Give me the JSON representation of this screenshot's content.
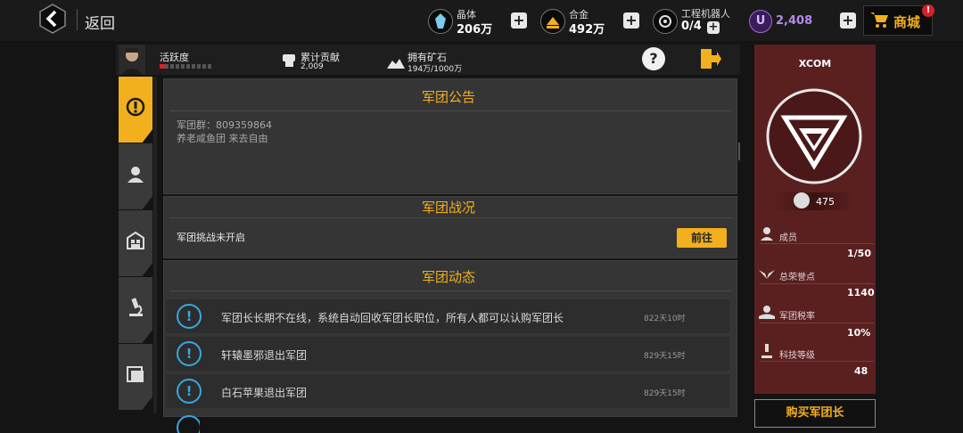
{
  "top": {
    "back_label": "返回",
    "resources": [
      {
        "name": "晶体",
        "value": "206万",
        "icon": "crystal-icon"
      },
      {
        "name": "合金",
        "value": "492万",
        "icon": "alloy-icon"
      },
      {
        "name": "工程机器人",
        "value": "0/4",
        "icon": "robot-icon"
      }
    ],
    "currency_value": "2,408",
    "shop_label": "商城",
    "shop_badge": "!"
  },
  "stats_bar": {
    "activity_label": "活跃度",
    "contribution_label": "累计贡献",
    "contribution_value": "2,009",
    "ore_label": "拥有矿石",
    "ore_value": "194万/1000万",
    "help_symbol": "?"
  },
  "announcement": {
    "title": "军团公告",
    "line1": "军团群：809359864",
    "line2": "养老咸鱼团 来去自由"
  },
  "battle": {
    "title": "军团战况",
    "status": "军团挑战未开启",
    "go_label": "前往"
  },
  "news": {
    "title": "军团动态",
    "items": [
      {
        "text": "军团长长期不在线，系统自动回收军团长职位，所有人都可以认购军团长",
        "time": "822天10时"
      },
      {
        "text": "轩辕墨邪退出军团",
        "time": "829天15时"
      },
      {
        "text": "白石苹果退出军团",
        "time": "829天15时"
      }
    ]
  },
  "legion": {
    "name": "XCOM",
    "level": "475",
    "members_label": "成员",
    "members_value": "1/50",
    "honor_label": "总荣誉点",
    "honor_value": "1140",
    "tax_label": "军团税率",
    "tax_value": "10%",
    "tech_label": "科技等级",
    "tech_value": "48",
    "buy_label": "购买军团长"
  },
  "colors": {
    "accent": "#f2b01e",
    "info": "#35a8e0",
    "legion_bg": "#5a2020"
  }
}
